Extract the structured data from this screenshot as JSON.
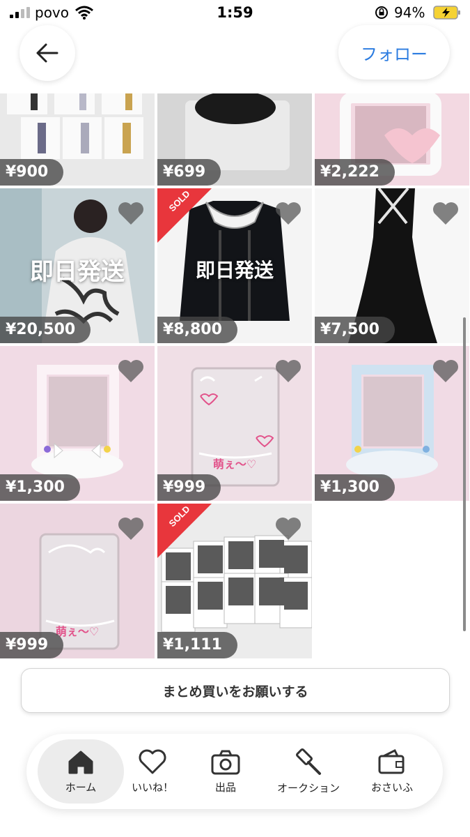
{
  "status_bar": {
    "carrier": "povo",
    "time": "1:59",
    "battery": "94%"
  },
  "header": {
    "follow_label": "フォロー"
  },
  "items": [
    {
      "price": "¥900",
      "sold": false,
      "liked_icon": false,
      "overlay": ""
    },
    {
      "price": "¥699",
      "sold": false,
      "liked_icon": false,
      "overlay": ""
    },
    {
      "price": "¥2,222",
      "sold": false,
      "liked_icon": false,
      "overlay": ""
    },
    {
      "price": "¥20,500",
      "sold": false,
      "liked_icon": true,
      "overlay": "即日発送"
    },
    {
      "price": "¥8,800",
      "sold": true,
      "liked_icon": true,
      "overlay": "即日発送",
      "sold_label": "SOLD"
    },
    {
      "price": "¥7,500",
      "sold": false,
      "liked_icon": true,
      "overlay": ""
    },
    {
      "price": "¥1,300",
      "sold": false,
      "liked_icon": true,
      "overlay": ""
    },
    {
      "price": "¥999",
      "sold": false,
      "liked_icon": true,
      "overlay": "",
      "handwriting": "萌ぇ〜♡"
    },
    {
      "price": "¥1,300",
      "sold": false,
      "liked_icon": true,
      "overlay": ""
    },
    {
      "price": "¥999",
      "sold": false,
      "liked_icon": true,
      "overlay": "",
      "handwriting": "萌ぇ〜♡"
    },
    {
      "price": "¥1,111",
      "sold": true,
      "liked_icon": true,
      "overlay": "",
      "sold_label": "SOLD"
    }
  ],
  "bulk_buy_label": "まとめ買いをお願いする",
  "nav": [
    {
      "label": "ホーム",
      "icon": "home-icon",
      "active": true
    },
    {
      "label": "いいね！",
      "icon": "heart-icon",
      "active": false
    },
    {
      "label": "出品",
      "icon": "camera-icon",
      "active": false
    },
    {
      "label": "オークション",
      "icon": "gavel-icon",
      "active": false
    },
    {
      "label": "おさいふ",
      "icon": "wallet-icon",
      "active": false
    }
  ],
  "colors": {
    "accent": "#2a7be0",
    "sold_ribbon": "#e8363c",
    "price_bg": "#464646"
  }
}
